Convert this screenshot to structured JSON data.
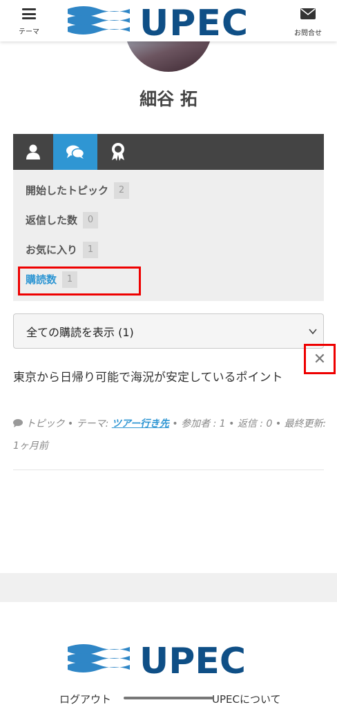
{
  "header": {
    "menu_label": "テーマ",
    "logo_text": "UPEC",
    "contact_label": "お問合せ"
  },
  "profile": {
    "name": "細谷 拓"
  },
  "profile_menu": {
    "items": [
      {
        "label": "開始したトピック",
        "count": "2"
      },
      {
        "label": "返信した数",
        "count": "0"
      },
      {
        "label": "お気に入り",
        "count": "1"
      },
      {
        "label": "購読数",
        "count": "1"
      }
    ]
  },
  "filter": {
    "selected": "全ての購読を表示 (1)"
  },
  "topic": {
    "title": "東京から日帰り可能で海況が安定しているポイント",
    "type_label": "トピック",
    "theme_prefix": "テーマ:",
    "theme_link": "ツアー行き先",
    "participants": "参加者 : 1",
    "replies": "返信 : 0",
    "last_updated": "最終更新: 1ヶ月前",
    "bullet": "•"
  },
  "footer": {
    "logo_text": "UPEC",
    "logout_label": "ログアウト",
    "about_label": "UPECについて"
  },
  "colors": {
    "accent": "#2f96d3",
    "brand": "#0f4f86",
    "highlight": "#e00000"
  }
}
